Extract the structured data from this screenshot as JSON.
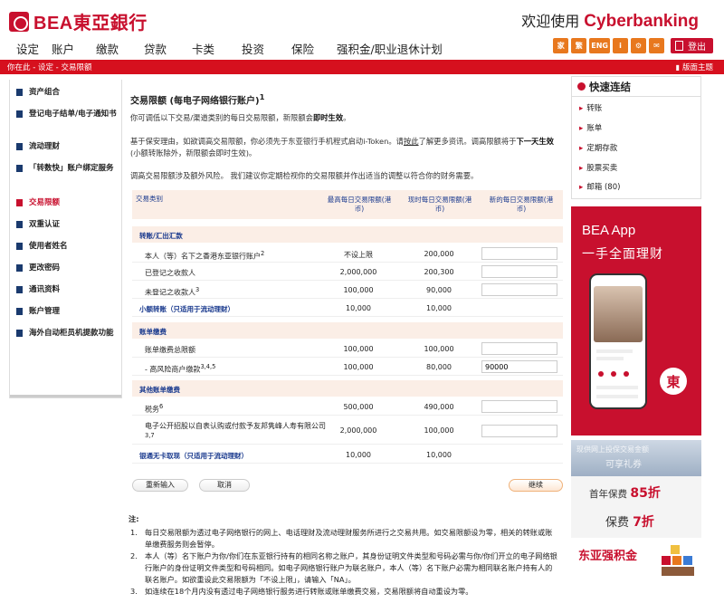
{
  "header": {
    "logo_text": "BEA東亞銀行",
    "welcome_prefix": "欢迎使用",
    "welcome_brand": "Cyberbanking"
  },
  "nav": {
    "items": [
      "设定",
      "账户",
      "缴款",
      "贷款",
      "卡类",
      "投资",
      "保险",
      "强积金/职业退休计划"
    ],
    "icons": [
      "家",
      "繁",
      "ENG",
      "i",
      "⚙",
      "✉"
    ],
    "logout": "登出"
  },
  "crumb": {
    "path": "你在此 - 设定 - 交易限额",
    "theme": "版面主题"
  },
  "sidebar": {
    "items": [
      {
        "label": "资产组合"
      },
      {
        "label": "登记电子结单/电子通知书"
      },
      {
        "label": "流动理财"
      },
      {
        "label": "「转数快」账户绑定服务"
      },
      {
        "label": "交易限额"
      },
      {
        "label": "双重认证"
      },
      {
        "label": "使用者姓名"
      },
      {
        "label": "更改密码"
      },
      {
        "label": "通讯资料"
      },
      {
        "label": "账户管理"
      },
      {
        "label": "海外自动柜员机提款功能"
      }
    ]
  },
  "content": {
    "title": "交易限额 (每电子网络银行账户)",
    "title_sup": "1",
    "p1": "你可调低以下交易/渠道类别的每日交易限额，新限额会",
    "p1_bold": "即时生效",
    "p1_end": "。",
    "p2a": "基于保安理由，如欲调高交易限额，你必须先于东亚银行手机程式启动i-Token。请",
    "p2_link": "按此",
    "p2b": "了解更多资讯。调高限额将于",
    "p2_bold": "下一天生效",
    "p2c": "(小额转账除外，新限额会即时生效)。",
    "p3": "调高交易限额涉及额外风险。 我们建议你定期检视你的交易限额并作出适当的调整以符合你的财务需要。"
  },
  "table": {
    "headers": {
      "category": "交易类别",
      "max": "最高每日交易限额(港币)",
      "current": "现时每日交易限额(港币)",
      "new": "新的每日交易限额(港币)"
    },
    "sections": {
      "transfer": "转账/汇出汇款",
      "bill": "账单缴费",
      "other_bill": "其他账单缴费"
    },
    "rows": {
      "own": {
        "label": "本人（等）名下之香港东亚银行账户",
        "sup": "2",
        "max": "不设上限",
        "current": "200,000",
        "new": ""
      },
      "registered": {
        "label": "已登记之收款人",
        "max": "2,000,000",
        "current": "200,300",
        "new": ""
      },
      "unregistered": {
        "label": "未登记之收款人",
        "sup": "3",
        "max": "100,000",
        "current": "90,000",
        "new": ""
      },
      "small": {
        "label": "小额转账（只适用于流动理财）",
        "max": "10,000",
        "current": "10,000"
      },
      "bill_total": {
        "label": "账单缴费总限额",
        "max": "100,000",
        "current": "100,000",
        "new": ""
      },
      "high_risk": {
        "label": "- 高风险商户缴款",
        "sup": "3,4,5",
        "max": "100,000",
        "current": "80,000",
        "new": "90000"
      },
      "tax": {
        "label": "税务",
        "sup": "6",
        "max": "500,000",
        "current": "490,000",
        "new": ""
      },
      "pay_to_friend": {
        "label": "电子公开招股以自表认购或付款予友邦隽峰人寿有限公司",
        "sup": "3,7",
        "max": "2,000,000",
        "current": "100,000",
        "new": ""
      },
      "cardless": {
        "label": "银通无卡取现（只适用于流动理财）",
        "max": "10,000",
        "current": "10,000"
      }
    }
  },
  "buttons": {
    "reset": "重新输入",
    "cancel": "取消",
    "next": "继续"
  },
  "notes": {
    "title": "注:",
    "items": [
      {
        "n": "1.",
        "text": "每日交易限额为透过电子网络银行的网上、电话理财及流动理财服务所进行之交易共用。如交易限额设为零，相关的转账或账单缴费服务则会暂停。"
      },
      {
        "n": "2.",
        "text": "本人（等）名下账户为你/你们在东亚银行持有的相同名称之账户，其身份证明文件类型和号码必需与你/你们开立的电子网络银行账户的身份证明文件类型和号码相同。如电子网络银行账户为联名账户，本人（等）名下账户必需为相同联名账户持有人的联名账户。如欲重设此交易限额为「不设上限」，请输入「NA」。"
      },
      {
        "n": "3.",
        "text": "如连续在18个月内没有透过电子网络银行服务进行转账或账单缴费交易，交易限额将自动重设为零。"
      }
    ]
  },
  "quick": {
    "title": "快速连结",
    "items": [
      "转账",
      "账单",
      "定期存款",
      "股票买卖",
      "邮箱 (80)"
    ]
  },
  "ads": {
    "app_title": "BEA App",
    "app_sub": "一手全面理财",
    "app_badge": "東",
    "insure_top": "现供网上投保交易金额",
    "insure_top_sub": "可享礼券",
    "insure_l1": "首年保费",
    "insure_l1_val": "85折",
    "insure_l2": "保费",
    "insure_l2_val": "7折",
    "mpf": "东亚强积金"
  }
}
